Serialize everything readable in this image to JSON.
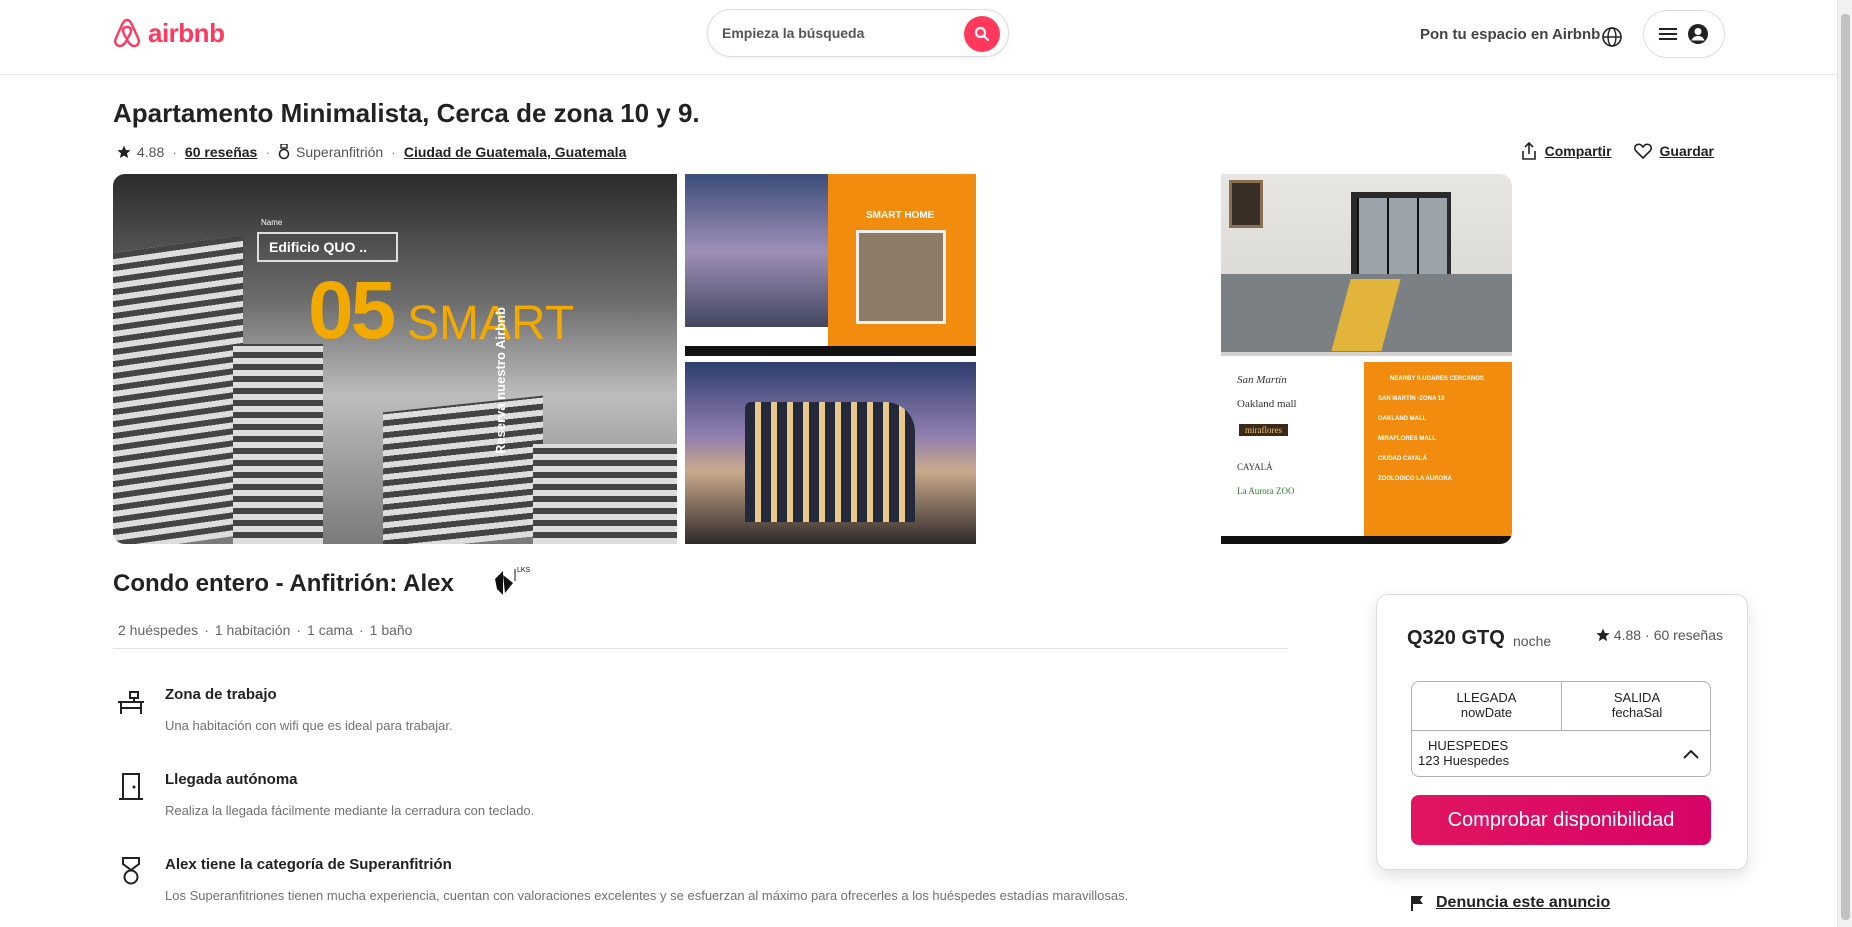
{
  "header": {
    "logo_text": "airbnb",
    "search_placeholder": "Empieza la búsqueda",
    "host_link": "Pon tu espacio en Airbnb",
    "brand_color": "#ff385c"
  },
  "listing": {
    "title": "Apartamento Minimalista, Cerca de zona 10 y 9.",
    "rating": "4.88",
    "reviews_link": "60 reseñas",
    "superhost": "Superanfitrión",
    "location": "Ciudad de Guatemala, Guatemala",
    "share": "Compartir",
    "save": "Guardar"
  },
  "photos": {
    "main": {
      "sign_label": "Name",
      "sign_text": "Edificio QUO ..",
      "big_number": "05",
      "big_word": "SMART",
      "vertical_text": "Reserva nuestro Airbnb"
    },
    "top_middle": {
      "label": "SMART HOME"
    },
    "bottom_right": {
      "heading": "NEARBY /LUGARES CERCANOS",
      "places": [
        "SAN MARTIN -ZONA 10",
        "OAKLAND MALL",
        "MIRAFLORES MALL",
        "CIUDAD CAYALÁ",
        "ZOOLOGICO LA AURORA"
      ],
      "logos": [
        "San Martín",
        "Oakland mall",
        "miraflores",
        "CAYALÁ",
        "La Aurora ZOO"
      ]
    }
  },
  "host": {
    "title": "Condo entero - Anfitrión: Alex",
    "avatar_text": "LKS",
    "specs": [
      "2 huéspedes",
      "1 habitación",
      "1 cama",
      "1 baño"
    ]
  },
  "features": [
    {
      "icon": "desk-icon",
      "title": "Zona de trabajo",
      "desc": "Una habitación con wifi que es ideal para trabajar."
    },
    {
      "icon": "door-icon",
      "title": "Llegada autónoma",
      "desc": "Realiza la llegada fácilmente mediante la cerradura con teclado."
    },
    {
      "icon": "medal-icon",
      "title": "Alex tiene la categoría de Superanfitrión",
      "desc": "Los Superanfitriones tienen mucha experiencia, cuentan con valoraciones excelentes y se esfuerzan al máximo para ofrecerles a los huéspedes estadías maravillosas."
    }
  ],
  "booking": {
    "price": "Q320 GTQ",
    "price_unit": "noche",
    "rating": "4.88",
    "reviews": "60 reseñas",
    "checkin_label": "LLEGADA",
    "checkin_value": "nowDate",
    "checkout_label": "SALIDA",
    "checkout_value": "fechaSal",
    "guests_label": "HUESPEDES",
    "guests_value": "123 Huespedes",
    "cta": "Comprobar disponibilidad",
    "cta_color": "#e01561"
  },
  "report": "Denuncia este anuncio"
}
